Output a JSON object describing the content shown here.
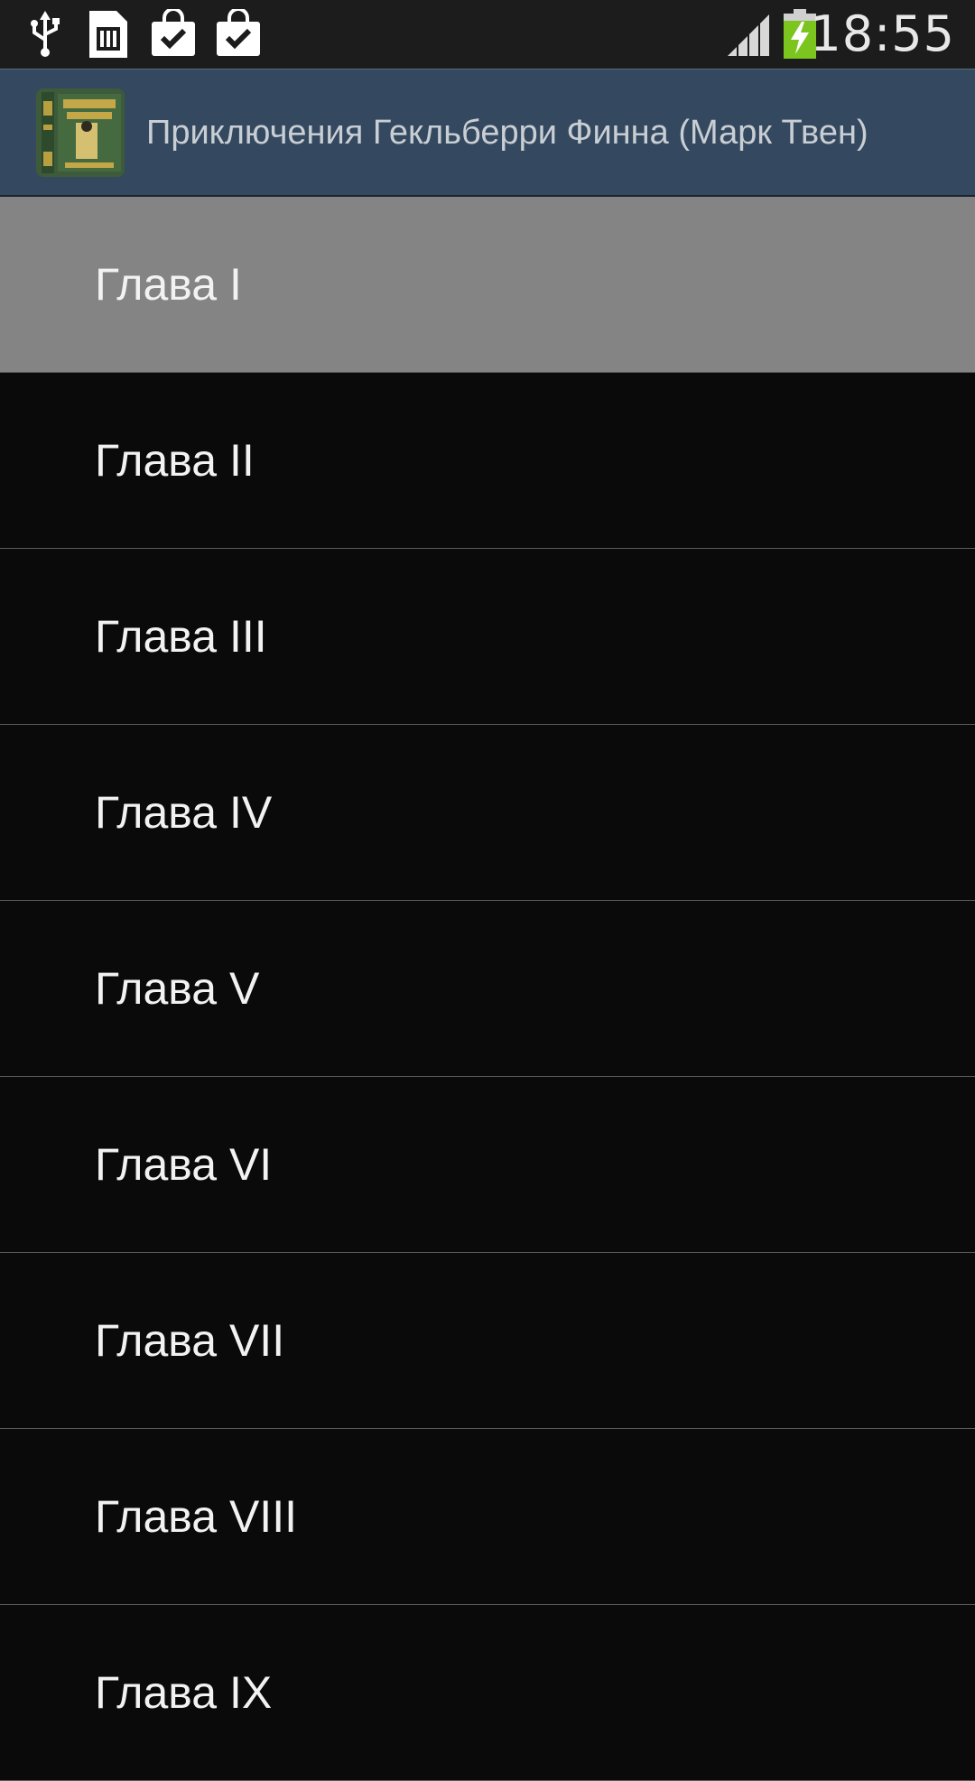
{
  "status_bar": {
    "time": "18:55",
    "icons": [
      "usb-icon",
      "sim-card-icon",
      "shopping-bag-check-icon",
      "shopping-bag-check-icon",
      "signal-icon",
      "battery-charging-icon"
    ]
  },
  "action_bar": {
    "title": "Приключения Гекльберри Финна (Марк Твен)",
    "icon": "book-cover-icon"
  },
  "chapters": [
    {
      "label": "Глава I",
      "selected": true
    },
    {
      "label": "Глава II",
      "selected": false
    },
    {
      "label": "Глава III",
      "selected": false
    },
    {
      "label": "Глава IV",
      "selected": false
    },
    {
      "label": "Глава V",
      "selected": false
    },
    {
      "label": "Глава VI",
      "selected": false
    },
    {
      "label": "Глава VII",
      "selected": false
    },
    {
      "label": "Глава VIII",
      "selected": false
    },
    {
      "label": "Глава IX",
      "selected": false
    }
  ],
  "colors": {
    "action_bar": "#34495f",
    "selected_row": "#848484",
    "list_background": "#0a0a0a",
    "battery": "#7cc51f"
  }
}
